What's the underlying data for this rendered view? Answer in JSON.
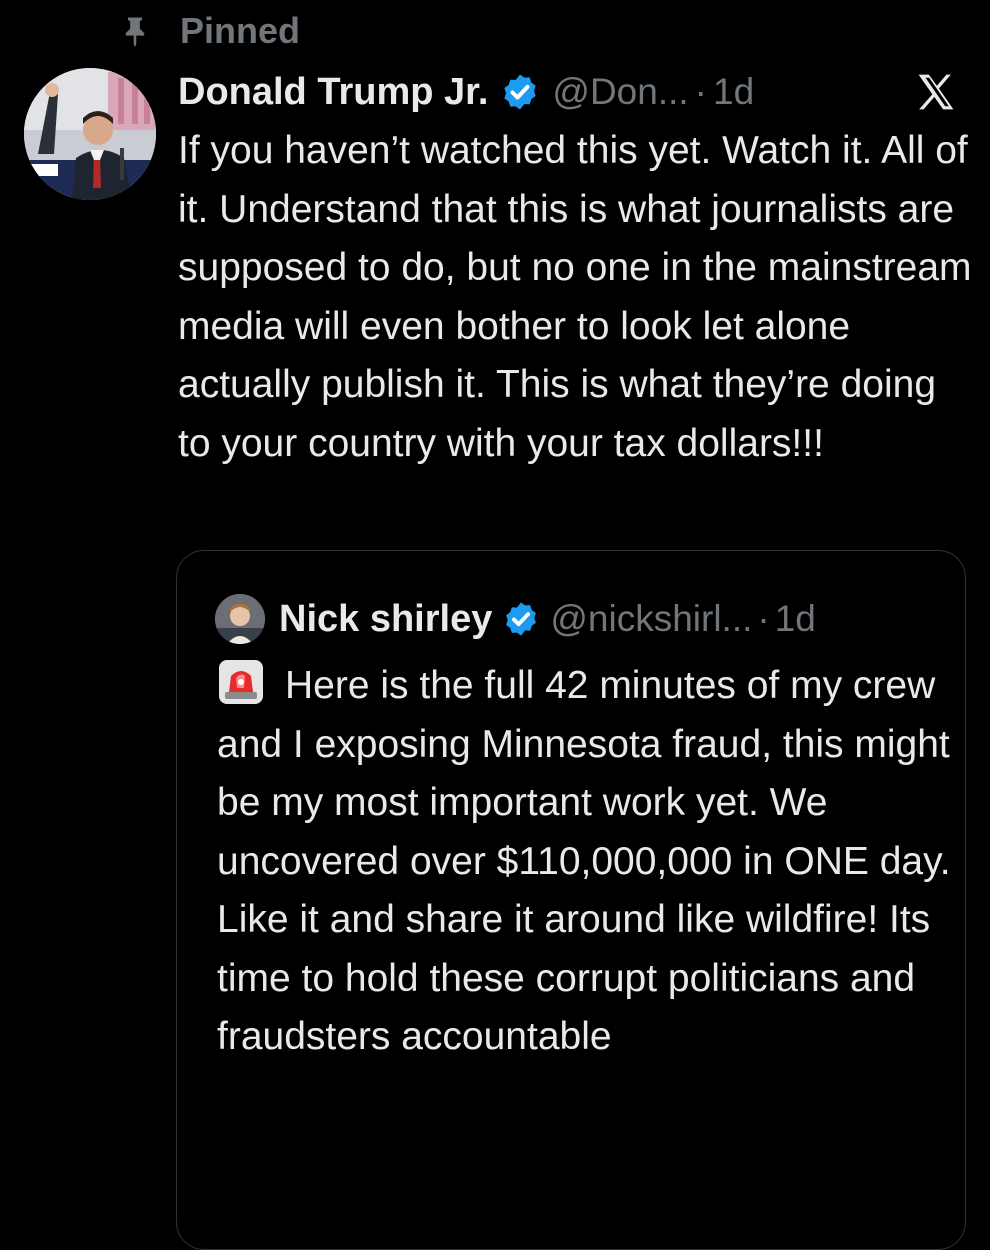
{
  "pinned": {
    "label": "Pinned",
    "icon": "pin-icon"
  },
  "tweet": {
    "author_name": "Donald Trump Jr.",
    "handle": "@Don...",
    "separator": "·",
    "time": "1d",
    "verified": true,
    "verified_color": "#1d9bf0",
    "platform_logo": "x-logo-icon",
    "text": "If you haven’t watched this yet. Watch it. All of it. Understand that this is what journalists are supposed to do, but no one in the mainstream media will even bother to look let alone actually publish it. This is what they’re doing to your country with your tax dollars!!!"
  },
  "quoted_tweet": {
    "author_name": "Nick shirley",
    "handle": "@nickshirl...",
    "separator": "·",
    "time": "1d",
    "verified": true,
    "leading_emoji": "police-siren-emoji",
    "text": "Here is the full 42 minutes of my crew and I exposing Minnesota fraud, this might be my most important work yet. We uncovered over $110,000,000 in ONE day. Like it and share it around like wildfire! Its time to hold these corrupt politicians and fraudsters accountable"
  },
  "colors": {
    "background": "#000000",
    "primary_text": "#e7e9ea",
    "secondary_text": "#71767b",
    "border": "#2f3336",
    "verified_blue": "#1d9bf0"
  }
}
